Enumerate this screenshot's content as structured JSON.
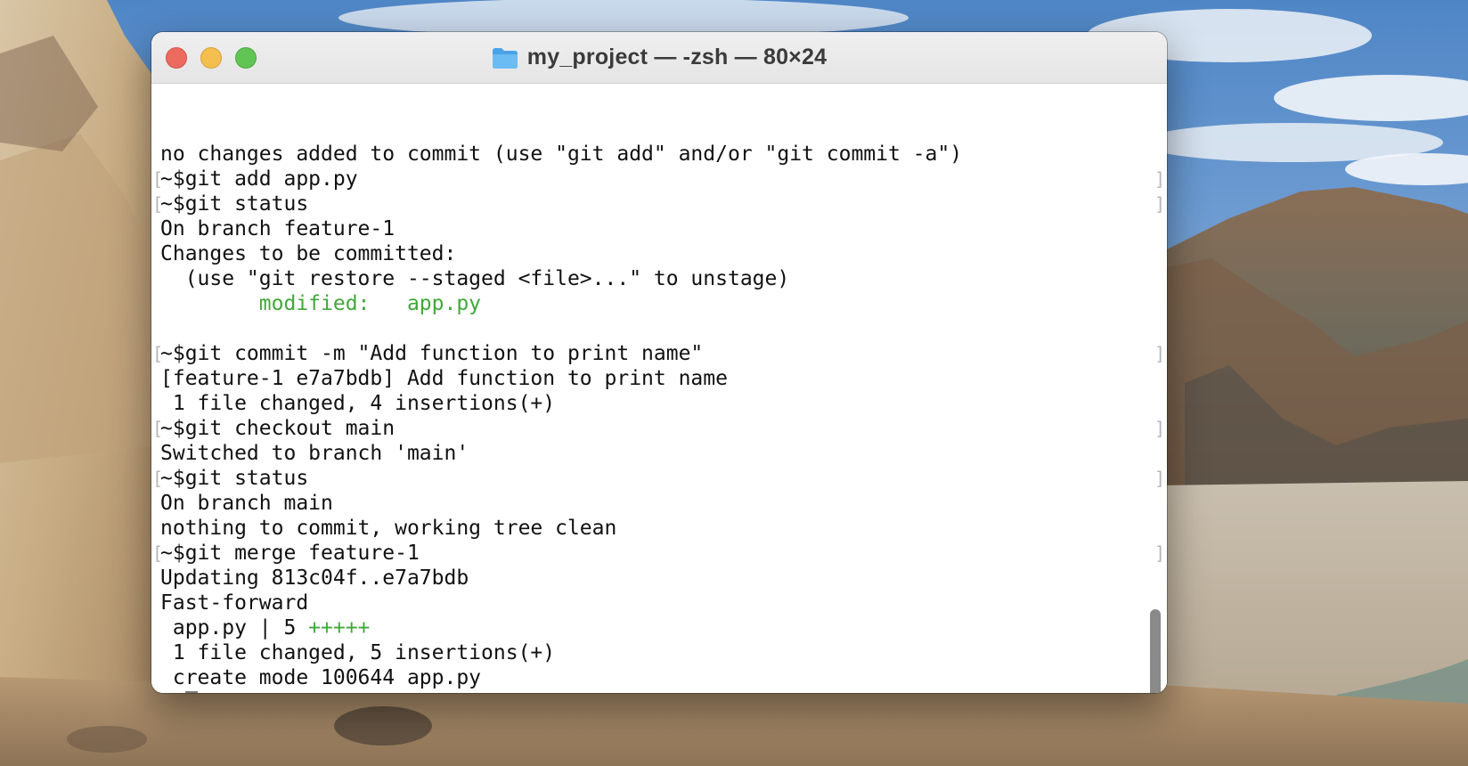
{
  "window": {
    "title": "my_project — -zsh — 80×24",
    "folder_icon": "folder-icon",
    "controls": {
      "close": "close-button",
      "minimize": "minimize-button",
      "zoom": "zoom-button"
    }
  },
  "colors": {
    "close": "#ed6a5e",
    "minimize": "#f5bf4f",
    "zoom": "#61c554",
    "text": "#111111",
    "git_green": "#41a83a"
  },
  "terminal": {
    "lines": [
      {
        "text": "no changes added to commit (use \"git add\" and/or \"git commit -a\")"
      },
      {
        "text": "~$git add app.py",
        "mark": true
      },
      {
        "text": "~$git status",
        "mark": true
      },
      {
        "text": "On branch feature-1"
      },
      {
        "text": "Changes to be committed:"
      },
      {
        "text": "  (use \"git restore --staged <file>...\" to unstage)"
      },
      {
        "prefix": "        ",
        "green": "modified:   app.py"
      },
      {
        "text": ""
      },
      {
        "text": "~$git commit -m \"Add function to print name\"",
        "mark": true
      },
      {
        "text": "[feature-1 e7a7bdb] Add function to print name"
      },
      {
        "text": " 1 file changed, 4 insertions(+)"
      },
      {
        "text": "~$git checkout main",
        "mark": true
      },
      {
        "text": "Switched to branch 'main'"
      },
      {
        "text": "~$git status",
        "mark": true
      },
      {
        "text": "On branch main"
      },
      {
        "text": "nothing to commit, working tree clean"
      },
      {
        "text": "~$git merge feature-1",
        "mark": true
      },
      {
        "text": "Updating 813c04f..e7a7bdb"
      },
      {
        "text": "Fast-forward"
      },
      {
        "text": " app.py | 5 ",
        "green_after": "+++++"
      },
      {
        "text": " 1 file changed, 5 insertions(+)"
      },
      {
        "text": " create mode 100644 app.py"
      },
      {
        "text": "~$",
        "cursor": true
      }
    ]
  }
}
